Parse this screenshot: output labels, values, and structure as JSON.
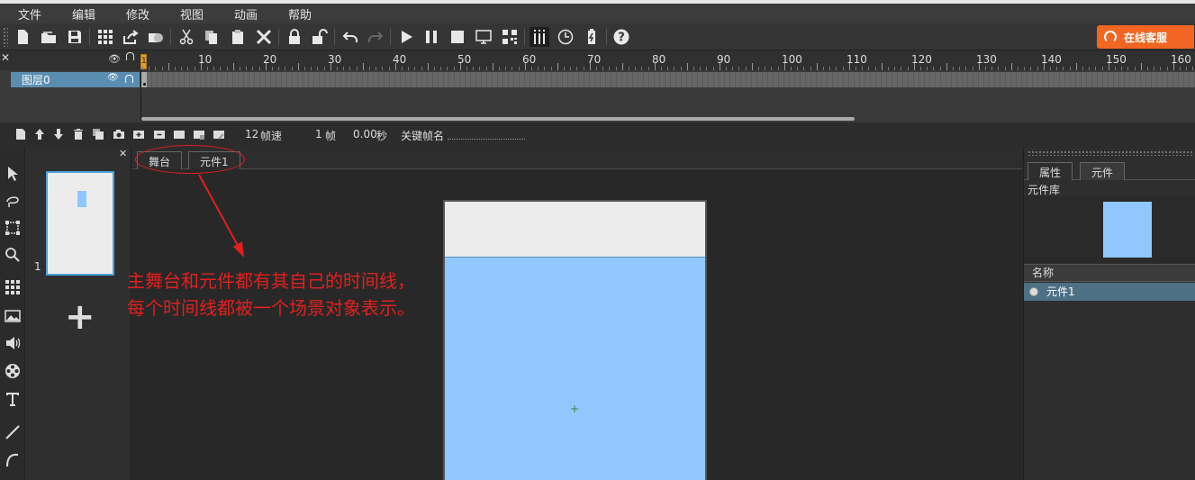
{
  "menu": [
    "文件",
    "编辑",
    "修改",
    "视图",
    "动画",
    "帮助"
  ],
  "toolbar": {
    "icons": [
      "new-file-icon",
      "open-folder-icon",
      "save-icon",
      "grid-icon",
      "share-icon",
      "shapes-icon",
      "cut-icon",
      "copy-icon",
      "paste-icon",
      "delete-icon",
      "lock-icon",
      "unlock-icon",
      "undo-icon",
      "redo-icon",
      "play-icon",
      "pause-icon",
      "stop-icon",
      "monitor-icon",
      "qrcode-icon",
      "bars-icon",
      "clock-icon",
      "battery-icon",
      "help-icon"
    ],
    "service_label": "在线客服"
  },
  "timeline": {
    "ruler_ticks": [
      "1",
      "10",
      "20",
      "30",
      "40",
      "50",
      "60",
      "70",
      "80",
      "90",
      "100",
      "110",
      "120",
      "130",
      "140",
      "150",
      "160"
    ],
    "layer_name": "图层0",
    "fps_value": "12",
    "fps_label": "帧速",
    "frame_value": "1",
    "frame_label": "帧",
    "time_value": "0.00",
    "time_label": "秒",
    "keyframe_name_label": "关键帧名"
  },
  "scenes": {
    "scene_number": "1",
    "add_label": "+"
  },
  "stage": {
    "tabs": [
      "舞台",
      "元件1"
    ],
    "registration_mark": "+"
  },
  "annotation": {
    "line1": "主舞台和元件都有其自己的时间线，",
    "line2": "每个时间线都被一个场景对象表示。",
    "color": "#e02020"
  },
  "right_panel": {
    "tabs": [
      "属性",
      "元件"
    ],
    "library_label": "元件库",
    "name_header": "名称",
    "items": [
      "元件1"
    ]
  },
  "colors": {
    "accent": "#f26522",
    "selection": "#5b8db0",
    "symbol_fill": "#90c7ff"
  }
}
